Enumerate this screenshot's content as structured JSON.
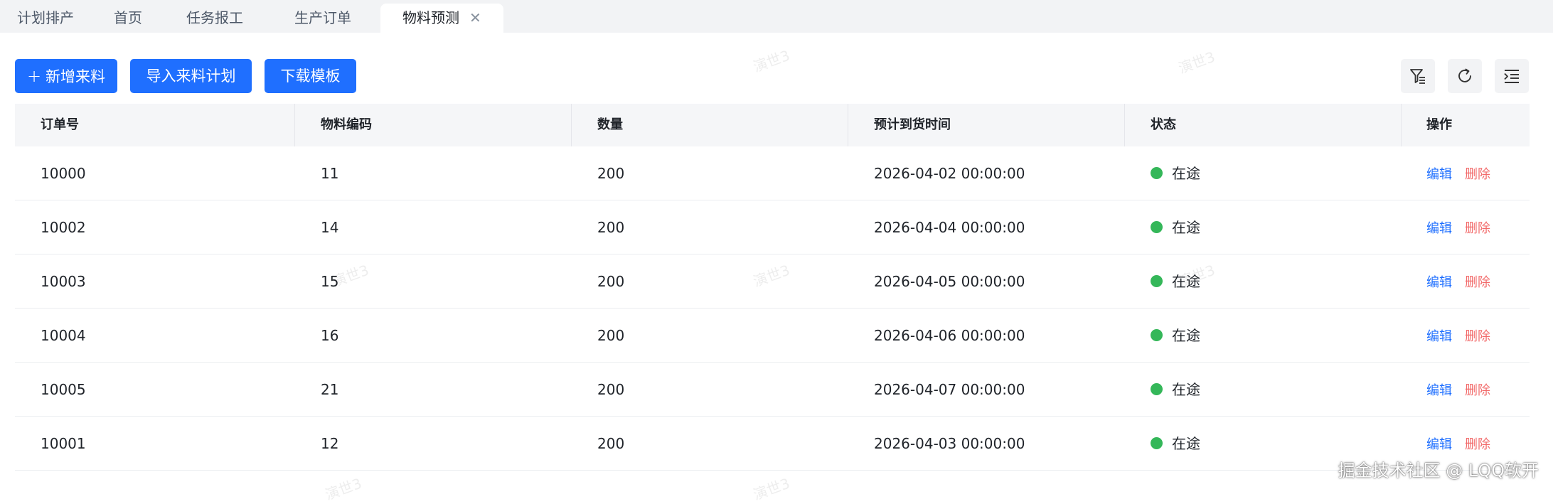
{
  "tabs": [
    {
      "label": "计划排产"
    },
    {
      "label": "首页"
    },
    {
      "label": "任务报工"
    },
    {
      "label": "生产订单"
    },
    {
      "label": "物料预测",
      "active": true
    }
  ],
  "toolbar": {
    "add_label": "新增来料",
    "import_label": "导入来料计划",
    "template_label": "下载模板"
  },
  "table": {
    "columns": [
      "订单号",
      "物料编码",
      "数量",
      "预计到货时间",
      "状态",
      "操作"
    ],
    "rows": [
      {
        "order": "10000",
        "code": "11",
        "qty": "200",
        "eta": "2026-04-02 00:00:00",
        "status": "在途"
      },
      {
        "order": "10002",
        "code": "14",
        "qty": "200",
        "eta": "2026-04-04 00:00:00",
        "status": "在途"
      },
      {
        "order": "10003",
        "code": "15",
        "qty": "200",
        "eta": "2026-04-05 00:00:00",
        "status": "在途"
      },
      {
        "order": "10004",
        "code": "16",
        "qty": "200",
        "eta": "2026-04-06 00:00:00",
        "status": "在途"
      },
      {
        "order": "10005",
        "code": "21",
        "qty": "200",
        "eta": "2026-04-07 00:00:00",
        "status": "在途"
      },
      {
        "order": "10001",
        "code": "12",
        "qty": "200",
        "eta": "2026-04-03 00:00:00",
        "status": "在途"
      }
    ],
    "edit_label": "编辑",
    "delete_label": "删除"
  },
  "watermark_text": "演世3",
  "footer_mark": "掘金技术社区 @ LQQ软开",
  "colors": {
    "primary": "#1f6fff",
    "danger": "#f26b6b",
    "status_ok": "#34b759"
  }
}
